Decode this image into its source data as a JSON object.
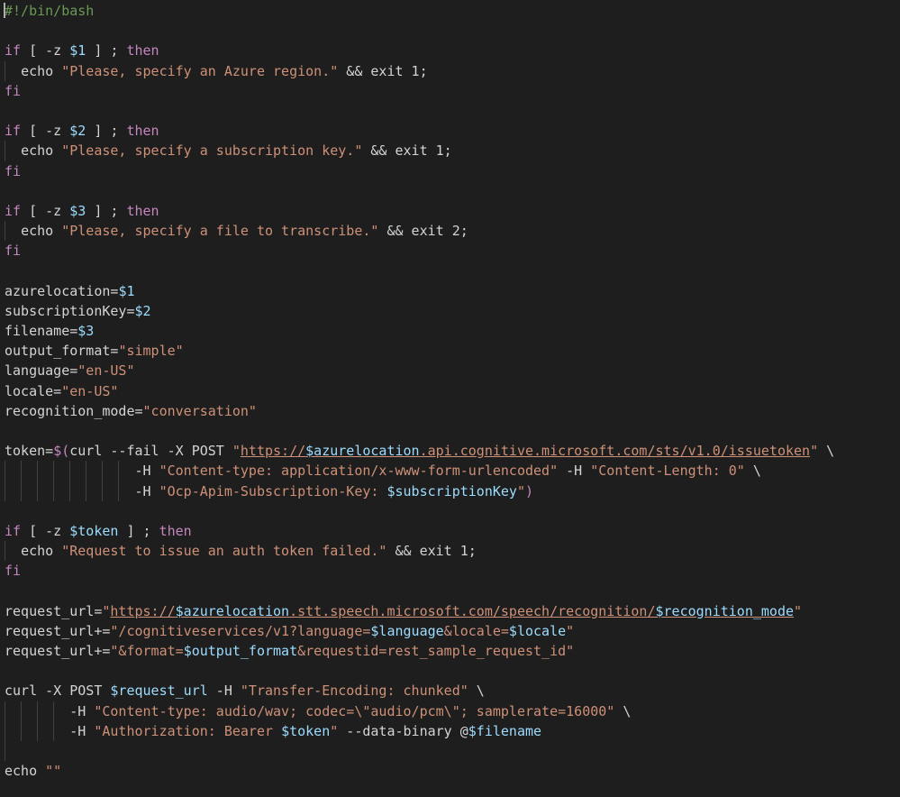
{
  "editor": {
    "language": "bash",
    "theme": {
      "background": "#1e1e1e",
      "foreground": "#d4d4d4",
      "comment": "#6a9955",
      "keyword": "#c586c0",
      "variable": "#9cdcfe",
      "string": "#ce9178",
      "number": "#b5cea8",
      "command": "#dcdcaa"
    },
    "lines": [
      {
        "indent_guides": 0,
        "tokens": [
          {
            "t": "comment",
            "v": "#!/bin/bash"
          }
        ]
      },
      {
        "indent_guides": 0,
        "tokens": []
      },
      {
        "indent_guides": 0,
        "tokens": [
          {
            "t": "keyword",
            "v": "if"
          },
          {
            "t": "plain",
            "v": " [ -z "
          },
          {
            "t": "var",
            "v": "$1"
          },
          {
            "t": "plain",
            "v": " ] ; "
          },
          {
            "t": "keyword",
            "v": "then"
          }
        ]
      },
      {
        "indent_guides": 1,
        "tokens": [
          {
            "t": "plain",
            "v": "  "
          },
          {
            "t": "plain",
            "v": "echo"
          },
          {
            "t": "plain",
            "v": " "
          },
          {
            "t": "string",
            "v": "\"Please, specify an Azure region.\""
          },
          {
            "t": "plain",
            "v": " && exit "
          },
          {
            "t": "plain",
            "v": "1"
          },
          {
            "t": "plain",
            "v": ";"
          }
        ]
      },
      {
        "indent_guides": 0,
        "tokens": [
          {
            "t": "keyword",
            "v": "fi"
          }
        ]
      },
      {
        "indent_guides": 0,
        "tokens": []
      },
      {
        "indent_guides": 0,
        "tokens": [
          {
            "t": "keyword",
            "v": "if"
          },
          {
            "t": "plain",
            "v": " [ -z "
          },
          {
            "t": "var",
            "v": "$2"
          },
          {
            "t": "plain",
            "v": " ] ; "
          },
          {
            "t": "keyword",
            "v": "then"
          }
        ]
      },
      {
        "indent_guides": 1,
        "tokens": [
          {
            "t": "plain",
            "v": "  "
          },
          {
            "t": "plain",
            "v": "echo"
          },
          {
            "t": "plain",
            "v": " "
          },
          {
            "t": "string",
            "v": "\"Please, specify a subscription key.\""
          },
          {
            "t": "plain",
            "v": " && exit "
          },
          {
            "t": "plain",
            "v": "1"
          },
          {
            "t": "plain",
            "v": ";"
          }
        ]
      },
      {
        "indent_guides": 0,
        "tokens": [
          {
            "t": "keyword",
            "v": "fi"
          }
        ]
      },
      {
        "indent_guides": 0,
        "tokens": []
      },
      {
        "indent_guides": 0,
        "tokens": [
          {
            "t": "keyword",
            "v": "if"
          },
          {
            "t": "plain",
            "v": " [ -z "
          },
          {
            "t": "var",
            "v": "$3"
          },
          {
            "t": "plain",
            "v": " ] ; "
          },
          {
            "t": "keyword",
            "v": "then"
          }
        ]
      },
      {
        "indent_guides": 1,
        "tokens": [
          {
            "t": "plain",
            "v": "  "
          },
          {
            "t": "plain",
            "v": "echo"
          },
          {
            "t": "plain",
            "v": " "
          },
          {
            "t": "string",
            "v": "\"Please, specify a file to transcribe.\""
          },
          {
            "t": "plain",
            "v": " && exit "
          },
          {
            "t": "plain",
            "v": "2"
          },
          {
            "t": "plain",
            "v": ";"
          }
        ]
      },
      {
        "indent_guides": 0,
        "tokens": [
          {
            "t": "keyword",
            "v": "fi"
          }
        ]
      },
      {
        "indent_guides": 0,
        "tokens": []
      },
      {
        "indent_guides": 0,
        "tokens": [
          {
            "t": "plain",
            "v": "azurelocation="
          },
          {
            "t": "var",
            "v": "$1"
          }
        ]
      },
      {
        "indent_guides": 0,
        "tokens": [
          {
            "t": "plain",
            "v": "subscriptionKey="
          },
          {
            "t": "var",
            "v": "$2"
          }
        ]
      },
      {
        "indent_guides": 0,
        "tokens": [
          {
            "t": "plain",
            "v": "filename="
          },
          {
            "t": "var",
            "v": "$3"
          }
        ]
      },
      {
        "indent_guides": 0,
        "tokens": [
          {
            "t": "plain",
            "v": "output_format="
          },
          {
            "t": "string",
            "v": "\"simple\""
          }
        ]
      },
      {
        "indent_guides": 0,
        "tokens": [
          {
            "t": "plain",
            "v": "language="
          },
          {
            "t": "string",
            "v": "\"en-US\""
          }
        ]
      },
      {
        "indent_guides": 0,
        "tokens": [
          {
            "t": "plain",
            "v": "locale="
          },
          {
            "t": "string",
            "v": "\"en-US\""
          }
        ]
      },
      {
        "indent_guides": 0,
        "tokens": [
          {
            "t": "plain",
            "v": "recognition_mode="
          },
          {
            "t": "string",
            "v": "\"conversation\""
          }
        ]
      },
      {
        "indent_guides": 0,
        "tokens": []
      },
      {
        "indent_guides": 0,
        "tokens": [
          {
            "t": "plain",
            "v": "token="
          },
          {
            "t": "keyword",
            "v": "$("
          },
          {
            "t": "plain",
            "v": "curl --fail -X POST "
          },
          {
            "t": "string",
            "v": "\""
          },
          {
            "t": "url",
            "v": "https://"
          },
          {
            "t": "urlvar",
            "v": "$azurelocation"
          },
          {
            "t": "url",
            "v": ".api.cognitive.microsoft.com/sts/v1.0/issuetoken"
          },
          {
            "t": "string",
            "v": "\""
          },
          {
            "t": "plain",
            "v": " \\"
          }
        ]
      },
      {
        "indent_guides": 8,
        "tokens": [
          {
            "t": "plain",
            "v": "                -H "
          },
          {
            "t": "string",
            "v": "\"Content-type: application/x-www-form-urlencoded\""
          },
          {
            "t": "plain",
            "v": " -H "
          },
          {
            "t": "string",
            "v": "\"Content-Length: 0\""
          },
          {
            "t": "plain",
            "v": " \\"
          }
        ]
      },
      {
        "indent_guides": 8,
        "tokens": [
          {
            "t": "plain",
            "v": "                -H "
          },
          {
            "t": "string",
            "v": "\"Ocp-Apim-Subscription-Key: "
          },
          {
            "t": "var",
            "v": "$subscriptionKey"
          },
          {
            "t": "string",
            "v": "\""
          },
          {
            "t": "keyword",
            "v": ")"
          }
        ]
      },
      {
        "indent_guides": 0,
        "tokens": []
      },
      {
        "indent_guides": 0,
        "tokens": [
          {
            "t": "keyword",
            "v": "if"
          },
          {
            "t": "plain",
            "v": " [ -z "
          },
          {
            "t": "var",
            "v": "$token"
          },
          {
            "t": "plain",
            "v": " ] ; "
          },
          {
            "t": "keyword",
            "v": "then"
          }
        ]
      },
      {
        "indent_guides": 1,
        "tokens": [
          {
            "t": "plain",
            "v": "  "
          },
          {
            "t": "plain",
            "v": "echo"
          },
          {
            "t": "plain",
            "v": " "
          },
          {
            "t": "string",
            "v": "\"Request to issue an auth token failed.\""
          },
          {
            "t": "plain",
            "v": " && exit "
          },
          {
            "t": "plain",
            "v": "1"
          },
          {
            "t": "plain",
            "v": ";"
          }
        ]
      },
      {
        "indent_guides": 0,
        "tokens": [
          {
            "t": "keyword",
            "v": "fi"
          }
        ]
      },
      {
        "indent_guides": 0,
        "tokens": []
      },
      {
        "indent_guides": 0,
        "tokens": [
          {
            "t": "plain",
            "v": "request_url="
          },
          {
            "t": "string",
            "v": "\""
          },
          {
            "t": "url",
            "v": "https://"
          },
          {
            "t": "urlvar",
            "v": "$azurelocation"
          },
          {
            "t": "url",
            "v": ".stt.speech.microsoft.com/speech/recognition/"
          },
          {
            "t": "urlvar",
            "v": "$recognition_mode"
          },
          {
            "t": "string",
            "v": "\""
          }
        ]
      },
      {
        "indent_guides": 0,
        "tokens": [
          {
            "t": "plain",
            "v": "request_url+="
          },
          {
            "t": "string",
            "v": "\"/cognitiveservices/v1?language="
          },
          {
            "t": "var",
            "v": "$language"
          },
          {
            "t": "string",
            "v": "&locale="
          },
          {
            "t": "var",
            "v": "$locale"
          },
          {
            "t": "string",
            "v": "\""
          }
        ]
      },
      {
        "indent_guides": 0,
        "tokens": [
          {
            "t": "plain",
            "v": "request_url+="
          },
          {
            "t": "string",
            "v": "\"&format="
          },
          {
            "t": "var",
            "v": "$output_format"
          },
          {
            "t": "string",
            "v": "&requestid=rest_sample_request_id\""
          }
        ]
      },
      {
        "indent_guides": 0,
        "tokens": []
      },
      {
        "indent_guides": 0,
        "tokens": [
          {
            "t": "plain",
            "v": "curl -X POST "
          },
          {
            "t": "var",
            "v": "$request_url"
          },
          {
            "t": "plain",
            "v": " -H "
          },
          {
            "t": "string",
            "v": "\"Transfer-Encoding: chunked\""
          },
          {
            "t": "plain",
            "v": " \\"
          }
        ]
      },
      {
        "indent_guides": 4,
        "tokens": [
          {
            "t": "plain",
            "v": "        -H "
          },
          {
            "t": "string",
            "v": "\"Content-type: audio/wav; codec=\\\"audio/pcm\\\"; samplerate=16000\""
          },
          {
            "t": "plain",
            "v": " \\"
          }
        ]
      },
      {
        "indent_guides": 4,
        "tokens": [
          {
            "t": "plain",
            "v": "        -H "
          },
          {
            "t": "string",
            "v": "\"Authorization: Bearer "
          },
          {
            "t": "var",
            "v": "$token"
          },
          {
            "t": "string",
            "v": "\""
          },
          {
            "t": "plain",
            "v": " --data-binary @"
          },
          {
            "t": "var",
            "v": "$filename"
          }
        ]
      },
      {
        "indent_guides": 1,
        "tokens": []
      },
      {
        "indent_guides": 0,
        "tokens": [
          {
            "t": "plain",
            "v": "echo "
          },
          {
            "t": "string",
            "v": "\"\""
          }
        ]
      }
    ]
  }
}
